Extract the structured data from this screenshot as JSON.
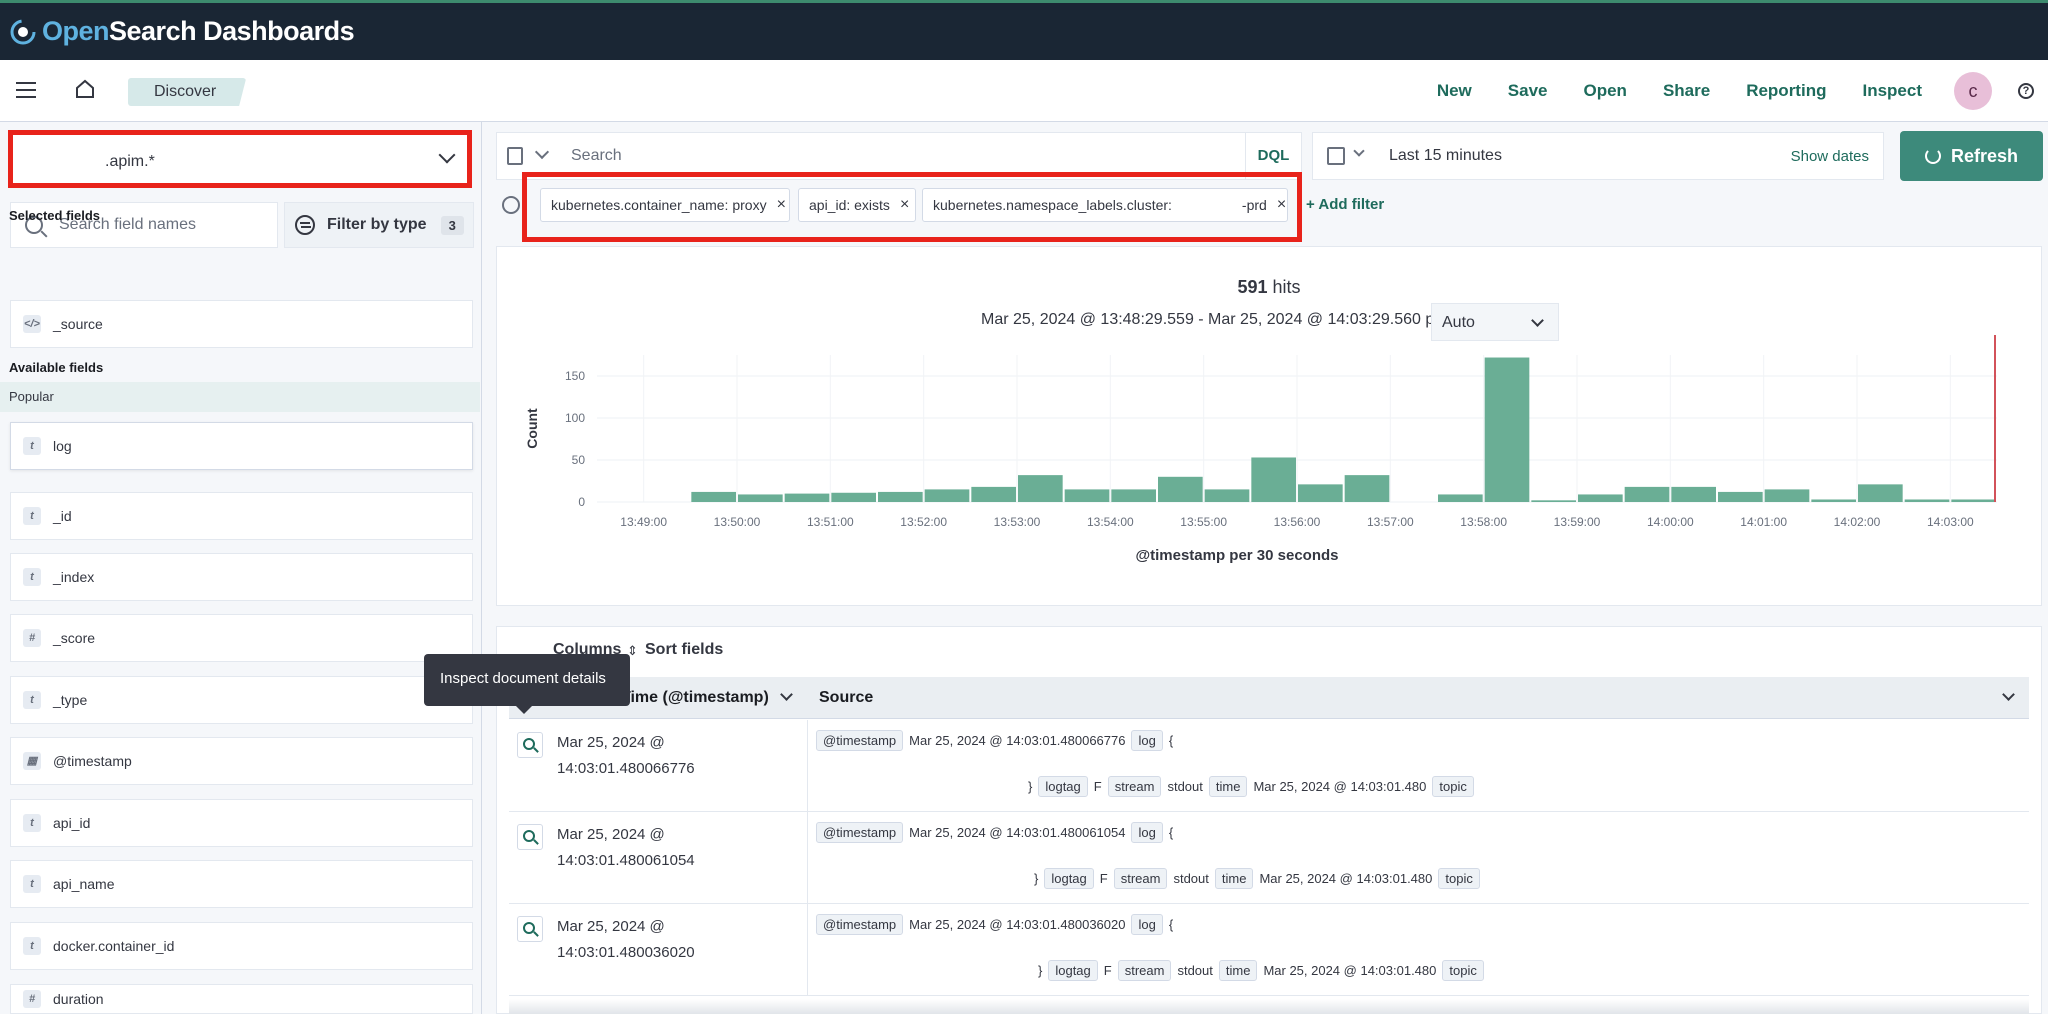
{
  "brand": {
    "open": "Open",
    "rest": "Search Dashboards"
  },
  "header": {
    "breadcrumb": "Discover",
    "nav": [
      "New",
      "Save",
      "Open",
      "Share",
      "Reporting",
      "Inspect"
    ],
    "avatar": "c",
    "help_icon": "?"
  },
  "sidebar": {
    "index_pattern": ".apim.*",
    "search_placeholder": "Search field names",
    "filter_by_type": "Filter by type",
    "filter_count": "3",
    "selected_fields_title": "Selected fields",
    "selected_fields": [
      {
        "type": "source",
        "name": "_source"
      }
    ],
    "available_fields_title": "Available fields",
    "popular_title": "Popular",
    "available_fields": [
      {
        "type": "t",
        "name": "log"
      },
      {
        "type": "t",
        "name": "_id"
      },
      {
        "type": "t",
        "name": "_index"
      },
      {
        "type": "#",
        "name": "_score"
      },
      {
        "type": "t",
        "name": "_type"
      },
      {
        "type": "date",
        "name": "@timestamp"
      },
      {
        "type": "t",
        "name": "api_id"
      },
      {
        "type": "t",
        "name": "api_name"
      },
      {
        "type": "t",
        "name": "docker.container_id"
      },
      {
        "type": "#",
        "name": "duration"
      }
    ]
  },
  "querybar": {
    "placeholder": "Search",
    "language": "DQL",
    "time_range": "Last 15 minutes",
    "show_dates": "Show dates",
    "refresh": "Refresh"
  },
  "filters": {
    "pills": [
      "kubernetes.container_name: proxy",
      "api_id: exists",
      "kubernetes.namespace_labels.cluster:",
      "-prd"
    ],
    "add_filter": "+ Add filter"
  },
  "histogram": {
    "hits_count": "591",
    "hits_label": "hits",
    "interval_text": "Mar 25, 2024 @ 13:48:29.559 - Mar 25, 2024 @ 14:03:29.560 per",
    "interval_value": "Auto"
  },
  "chart_data": {
    "type": "bar",
    "xlabel": "@timestamp per 30 seconds",
    "ylabel": "Count",
    "ylim": [
      0,
      175
    ],
    "yticks": [
      0,
      50,
      100,
      150
    ],
    "xticks": [
      "13:49:00",
      "13:50:00",
      "13:51:00",
      "13:52:00",
      "13:53:00",
      "13:54:00",
      "13:55:00",
      "13:56:00",
      "13:57:00",
      "13:58:00",
      "13:59:00",
      "14:00:00",
      "14:01:00",
      "14:02:00",
      "14:03:00"
    ],
    "categories": [
      "13:48:30",
      "13:49:00",
      "13:49:30",
      "13:50:00",
      "13:50:30",
      "13:51:00",
      "13:51:30",
      "13:52:00",
      "13:52:30",
      "13:53:00",
      "13:53:30",
      "13:54:00",
      "13:54:30",
      "13:55:00",
      "13:55:30",
      "13:56:00",
      "13:56:30",
      "13:57:00",
      "13:57:30",
      "13:58:00",
      "13:58:30",
      "13:59:00",
      "13:59:30",
      "14:00:00",
      "14:00:30",
      "14:01:00",
      "14:01:30",
      "14:02:00",
      "14:02:30",
      "14:03:00"
    ],
    "values": [
      0,
      0,
      12,
      9,
      10,
      11,
      12,
      15,
      18,
      32,
      15,
      15,
      30,
      15,
      53,
      21,
      32,
      0,
      9,
      172,
      2,
      9,
      18,
      18,
      12,
      15,
      3,
      21,
      3,
      3
    ],
    "color": "#6aae95",
    "now_marker_color": "#d2525a"
  },
  "table": {
    "columns_label": "Columns",
    "sort_label": "Sort fields",
    "time_header": "Time (@timestamp)",
    "source_header": "Source",
    "tooltip": "Inspect document details",
    "rows": [
      {
        "time": "Mar 25, 2024 @ 14:03:01.480066776",
        "ts_value": "Mar 25, 2024 @ 14:03:01.480066776",
        "logtag": "F",
        "stream": "stdout",
        "time_val": "Mar 25, 2024 @ 14:03:01.480"
      },
      {
        "time": "Mar 25, 2024 @ 14:03:01.480061054",
        "ts_value": "Mar 25, 2024 @ 14:03:01.480061054",
        "logtag": "F",
        "stream": "stdout",
        "time_val": "Mar 25, 2024 @ 14:03:01.480"
      },
      {
        "time": "Mar 25, 2024 @ 14:03:01.480036020",
        "ts_value": "Mar 25, 2024 @ 14:03:01.480036020",
        "logtag": "F",
        "stream": "stdout",
        "time_val": "Mar 25, 2024 @ 14:03:01.480"
      }
    ],
    "keys": {
      "ts": "@timestamp",
      "log": "log",
      "logtag": "logtag",
      "stream": "stream",
      "time": "time",
      "topic": "topic"
    }
  }
}
